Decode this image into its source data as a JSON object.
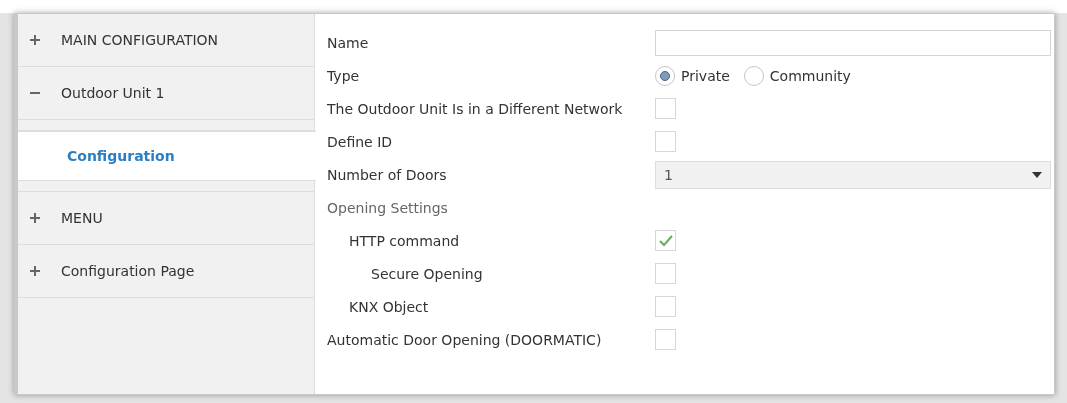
{
  "sidebar": {
    "items": [
      {
        "label": "MAIN CONFIGURATION",
        "expanded": false
      },
      {
        "label": "Outdoor Unit 1",
        "expanded": true,
        "children": [
          {
            "label": "Configuration",
            "selected": true
          }
        ]
      },
      {
        "label": "MENU",
        "expanded": false
      },
      {
        "label": "Configuration Page",
        "expanded": false
      }
    ]
  },
  "form": {
    "rows": [
      {
        "kind": "text",
        "label": "Name",
        "value": ""
      },
      {
        "kind": "radio",
        "label": "Type",
        "options": [
          {
            "label": "Private",
            "selected": true
          },
          {
            "label": "Community",
            "selected": false
          }
        ]
      },
      {
        "kind": "checkbox",
        "label": "The Outdoor Unit Is in a Different Network",
        "checked": false
      },
      {
        "kind": "checkbox",
        "label": "Define ID",
        "checked": false
      },
      {
        "kind": "dropdown",
        "label": "Number of Doors",
        "value": "1"
      },
      {
        "kind": "heading",
        "label": "Opening Settings",
        "children": [
          {
            "kind": "checkbox",
            "label": "HTTP command",
            "checked": true,
            "children": [
              {
                "kind": "checkbox",
                "label": "Secure Opening",
                "checked": false
              }
            ]
          },
          {
            "kind": "checkbox",
            "label": "KNX Object",
            "checked": false
          }
        ]
      },
      {
        "kind": "checkbox",
        "label": "Automatic Door Opening (DOORMATIC)",
        "checked": false
      }
    ]
  }
}
